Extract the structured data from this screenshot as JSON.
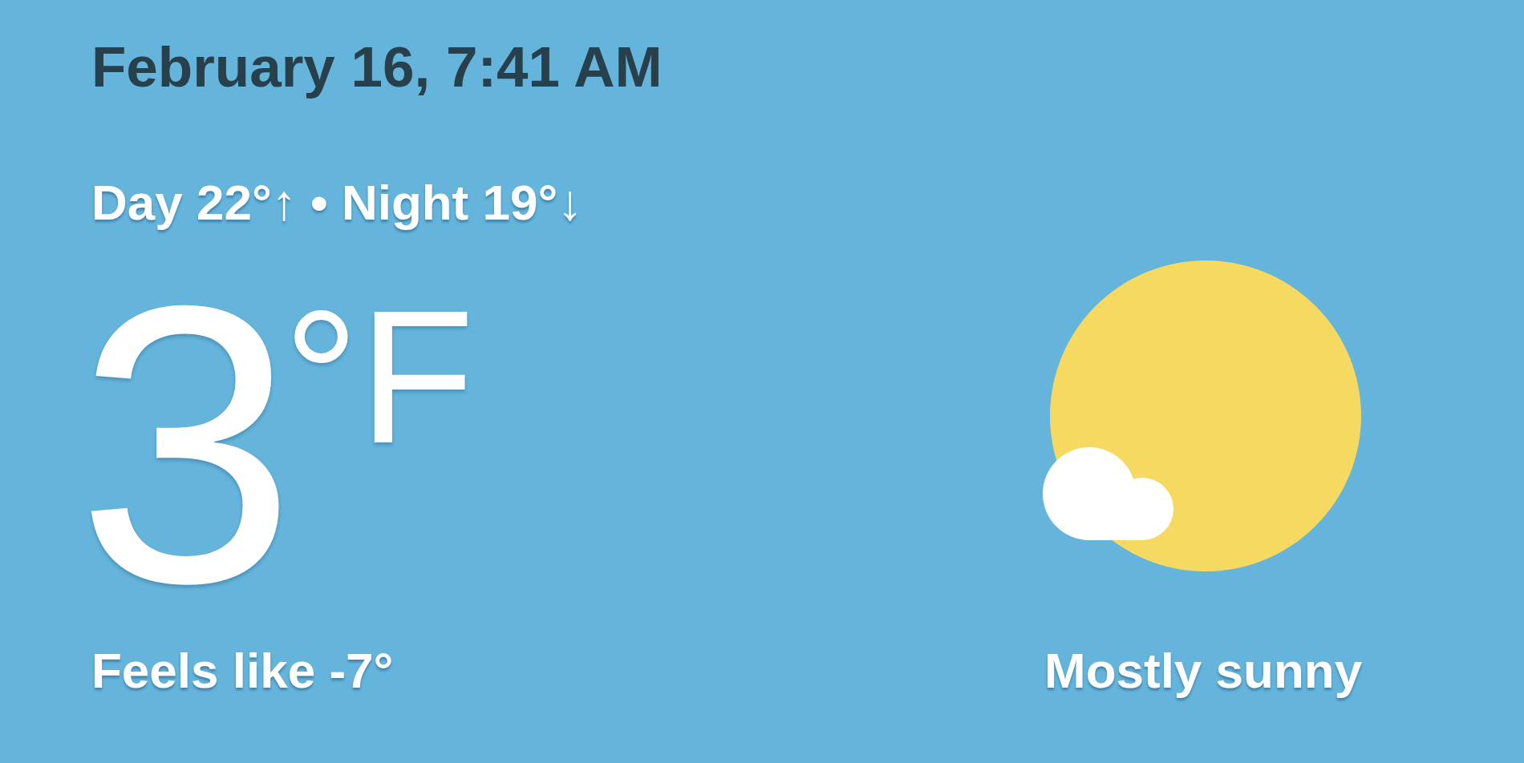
{
  "date_time": "February 16, 7:41 AM",
  "day_night": "Day 22°↑ • Night 19°↓",
  "temperature": {
    "value": "3",
    "unit": "°F"
  },
  "feels_like": "Feels like -7°",
  "condition": "Mostly sunny"
}
